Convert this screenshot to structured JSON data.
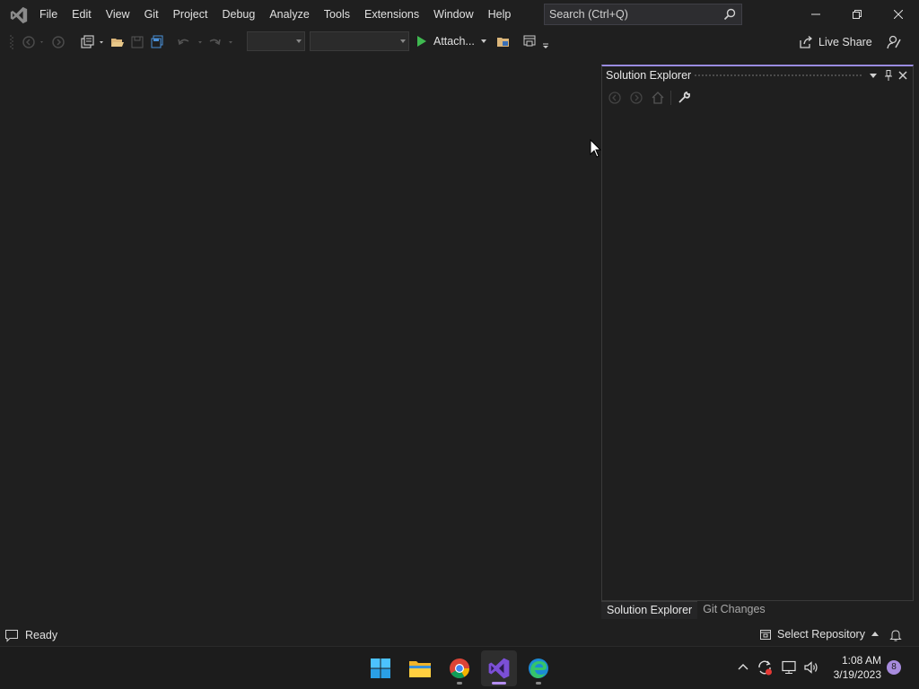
{
  "menu": [
    "File",
    "Edit",
    "View",
    "Git",
    "Project",
    "Debug",
    "Analyze",
    "Tools",
    "Extensions",
    "Window",
    "Help"
  ],
  "search": {
    "placeholder": "Search (Ctrl+Q)"
  },
  "toolbar": {
    "attach_label": "Attach...",
    "live_share_label": "Live Share"
  },
  "solution_explorer": {
    "title": "Solution Explorer"
  },
  "bottom_tabs": [
    "Solution Explorer",
    "Git Changes"
  ],
  "status": {
    "ready": "Ready",
    "select_repository": "Select Repository"
  },
  "taskbar": {
    "time": "1:08 AM",
    "date": "3/19/2023",
    "notification_count": "8"
  },
  "colors": {
    "accent": "#9a8ce0",
    "background": "#1f1f1f",
    "run_green": "#3fb950"
  }
}
